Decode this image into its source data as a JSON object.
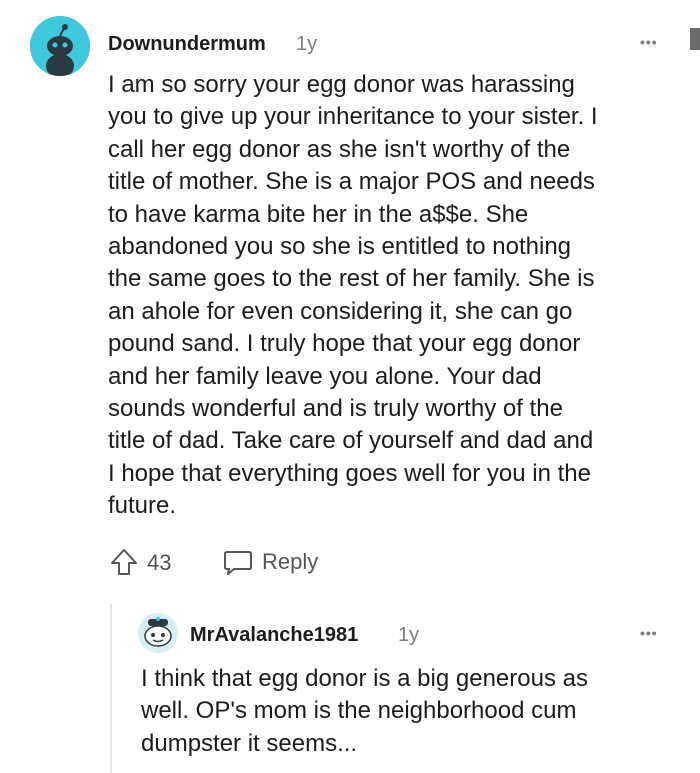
{
  "comment": {
    "username": "Downundermum",
    "age": "1y",
    "body_lines": [
      "I am so sorry your egg donor was harassing",
      "you to give up your inheritance to your sister. I",
      "call her egg donor as she isn't worthy of the",
      "title of mother. She is a major POS and needs",
      "to have karma bite her in the a$$e. She",
      "abandoned you so she is entitled to nothing",
      "the same goes to the rest of her family. She is",
      "an ahole for even considering it, she can go",
      "pound sand. I truly hope that your egg donor",
      "and her family leave you alone. Your dad",
      "sounds wonderful and is truly worthy of the",
      "title of dad. Take care of yourself and dad and",
      "I hope that everything goes well for you in the",
      "future."
    ],
    "vote_count": "43",
    "reply_label": "Reply",
    "menu": "•••"
  },
  "reply": {
    "username": "MrAvalanche1981",
    "age": "1y",
    "body_lines": [
      "I think that egg donor is a big generous as",
      "well. OP's mom is the neighborhood cum",
      "dumpster it seems..."
    ],
    "menu": "•••"
  },
  "colors": {
    "avatar_bg": "#3ec8de",
    "muted": "#7c7c7c",
    "text": "#1c1c1c"
  }
}
